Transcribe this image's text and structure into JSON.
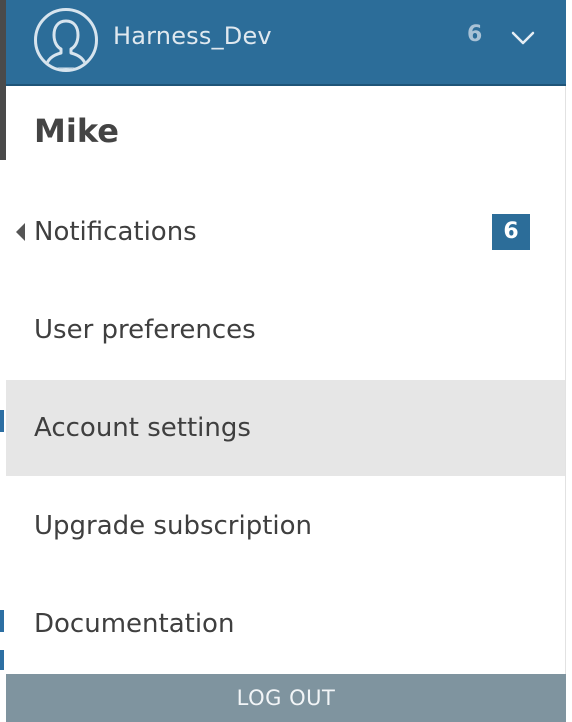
{
  "header": {
    "account_name": "Harness_Dev",
    "notification_count": "6",
    "avatar_icon": "user-avatar-icon",
    "chevron_icon": "chevron-down-icon"
  },
  "menu": {
    "user_name": "Mike",
    "items": [
      {
        "label": "Notifications",
        "badge": "6"
      },
      {
        "label": "User preferences"
      },
      {
        "label": "Account settings"
      },
      {
        "label": "Upgrade subscription"
      },
      {
        "label": "Documentation"
      }
    ],
    "logout_label": "LOG OUT"
  },
  "colors": {
    "header_bg": "#2c6d99",
    "badge_bg": "#2c6d99",
    "active_item_bg": "#e6e6e6",
    "logout_bg": "#7f949f"
  }
}
